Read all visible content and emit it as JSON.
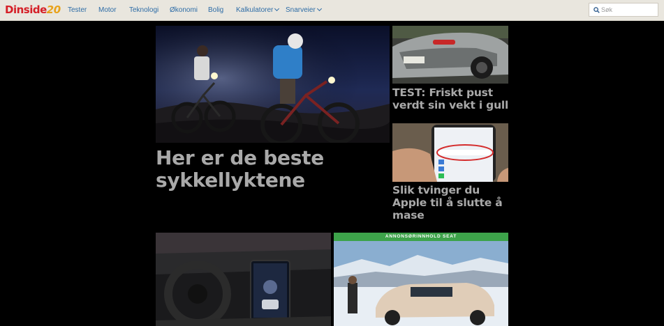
{
  "logo": {
    "part1": "Din",
    "part2": "side",
    "part3": "20"
  },
  "nav": {
    "items": [
      {
        "label": "Tester"
      },
      {
        "label": "Motor"
      },
      {
        "label": "Teknologi"
      },
      {
        "label": "Økonomi"
      },
      {
        "label": "Bolig"
      },
      {
        "label": "Kalkulatorer"
      },
      {
        "label": "Snarveier"
      }
    ]
  },
  "search": {
    "placeholder": "Søk"
  },
  "articles": {
    "main": {
      "headline": "Her er de beste sykkellyktene"
    },
    "right_top": {
      "headline": "TEST: Friskt pust verdt sin vekt i gull"
    },
    "right_middle": {
      "headline": "Slik tvinger du Apple til å slutte å mase"
    },
    "ad": {
      "label": "ANNONSØRINNHOLD SEAT"
    }
  },
  "colors": {
    "page_bg": "#000000",
    "nav_bg": "#e9e6de",
    "nav_link": "#2d6ca6",
    "headline": "#a9a9a9",
    "ad_label_bg": "#3da34a",
    "logo_red": "#d51f27",
    "logo_orange": "#e8a21a"
  },
  "icons": {
    "search": "search-icon",
    "dropdown": "chevron-down-icon"
  }
}
